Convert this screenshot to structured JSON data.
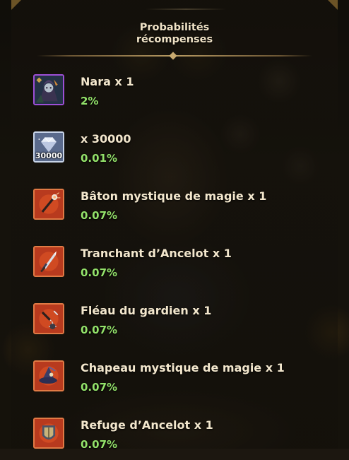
{
  "header": {
    "title_line1": "Probabilités",
    "title_line2": "récompenses"
  },
  "rewards": [
    {
      "name": "Nara x 1",
      "probability": "2%",
      "icon": "nara-hero-portrait-icon"
    },
    {
      "name": " x 30000",
      "probability": "0.01%",
      "icon": "diamond-gem-icon",
      "icon_label": "30000"
    },
    {
      "name": "Bâton mystique de magie x 1",
      "probability": "0.07%",
      "icon": "mystic-staff-icon"
    },
    {
      "name": "Tranchant d’Ancelot x 1",
      "probability": "0.07%",
      "icon": "ancelot-blade-icon"
    },
    {
      "name": "Fléau du gardien x 1",
      "probability": "0.07%",
      "icon": "guardian-flail-icon"
    },
    {
      "name": "Chapeau mystique de magie x 1",
      "probability": "0.07%",
      "icon": "mystic-hat-icon"
    },
    {
      "name": "Refuge d’Ancelot x 1",
      "probability": "0.07%",
      "icon": "ancelot-refuge-icon"
    }
  ],
  "colors": {
    "probability": "#93e26a",
    "item_name": "#f3e7cd",
    "hero_frame": "#9d4fd6",
    "equipment_frame": "#e07a45",
    "gem_frame": "#c8d4e8"
  }
}
